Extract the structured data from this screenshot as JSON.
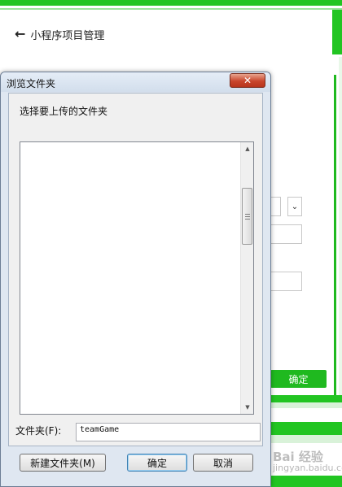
{
  "background_page": {
    "back_arrow_icon": "arrow-left-icon",
    "title": "小程序项目管理",
    "confirm_label": "确定",
    "watermark": {
      "brand": "Bai 经验",
      "url": "jingyan.baidu.com"
    },
    "colors": {
      "accent": "#22c522"
    }
  },
  "dialog": {
    "title": "浏览文件夹",
    "close_icon": "close-icon",
    "instruction": "选择要上传的文件夹",
    "folder_label": "文件夹(F):",
    "folder_value": "teamGame",
    "buttons": {
      "new_folder": "新建文件夹(M)",
      "ok": "确定",
      "cancel": "取消"
    }
  }
}
